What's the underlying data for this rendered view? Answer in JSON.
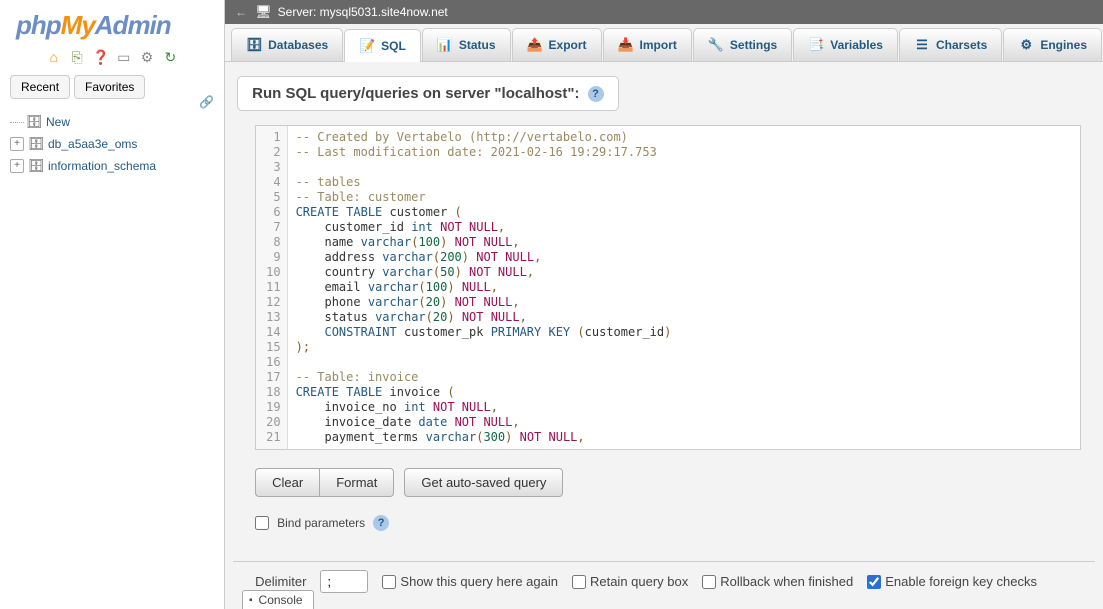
{
  "logo": {
    "part1": "php",
    "part2": "My",
    "part3": "Admin"
  },
  "sidebar": {
    "recent": "Recent",
    "favorites": "Favorites",
    "new": "New",
    "dbs": [
      "db_a5aa3e_oms",
      "information_schema"
    ]
  },
  "topbar": {
    "server_label": "Server:",
    "server_name": "mysql5031.site4now.net"
  },
  "tabs": {
    "databases": "Databases",
    "sql": "SQL",
    "status": "Status",
    "export": "Export",
    "import": "Import",
    "settings": "Settings",
    "variables": "Variables",
    "charsets": "Charsets",
    "engines": "Engines"
  },
  "panel": {
    "heading": "Run SQL query/queries on server \"localhost\":"
  },
  "code_lines": [
    {
      "n": 1,
      "t": "cmnt",
      "s": "-- Created by Vertabelo (http://vertabelo.com)"
    },
    {
      "n": 2,
      "t": "cmnt",
      "s": "-- Last modification date: 2021-02-16 19:29:17.753"
    },
    {
      "n": 3,
      "t": "",
      "s": ""
    },
    {
      "n": 4,
      "t": "cmnt",
      "s": "-- tables"
    },
    {
      "n": 5,
      "t": "cmnt",
      "s": "-- Table: customer"
    },
    {
      "n": 6,
      "t": "mix",
      "parts": [
        [
          "kw",
          "CREATE TABLE"
        ],
        [
          "",
          " "
        ],
        [
          "id",
          "customer"
        ],
        [
          "",
          " "
        ],
        [
          "p",
          "("
        ]
      ]
    },
    {
      "n": 7,
      "t": "mix",
      "parts": [
        [
          "",
          "    "
        ],
        [
          "id",
          "customer_id"
        ],
        [
          "",
          " "
        ],
        [
          "type",
          "int"
        ],
        [
          "",
          " "
        ],
        [
          "null",
          "NOT NULL"
        ],
        [
          "p",
          ","
        ]
      ]
    },
    {
      "n": 8,
      "t": "mix",
      "parts": [
        [
          "",
          "    "
        ],
        [
          "id",
          "name"
        ],
        [
          "",
          " "
        ],
        [
          "type",
          "varchar"
        ],
        [
          "p",
          "("
        ],
        [
          "num",
          "100"
        ],
        [
          "p",
          ")"
        ],
        [
          "",
          " "
        ],
        [
          "null",
          "NOT NULL"
        ],
        [
          "p",
          ","
        ]
      ]
    },
    {
      "n": 9,
      "t": "mix",
      "parts": [
        [
          "",
          "    "
        ],
        [
          "id",
          "address"
        ],
        [
          "",
          " "
        ],
        [
          "type",
          "varchar"
        ],
        [
          "p",
          "("
        ],
        [
          "num",
          "200"
        ],
        [
          "p",
          ")"
        ],
        [
          "",
          " "
        ],
        [
          "null",
          "NOT NULL"
        ],
        [
          "p",
          ","
        ]
      ]
    },
    {
      "n": 10,
      "t": "mix",
      "parts": [
        [
          "",
          "    "
        ],
        [
          "id",
          "country"
        ],
        [
          "",
          " "
        ],
        [
          "type",
          "varchar"
        ],
        [
          "p",
          "("
        ],
        [
          "num",
          "50"
        ],
        [
          "p",
          ")"
        ],
        [
          "",
          " "
        ],
        [
          "null",
          "NOT NULL"
        ],
        [
          "p",
          ","
        ]
      ]
    },
    {
      "n": 11,
      "t": "mix",
      "parts": [
        [
          "",
          "    "
        ],
        [
          "id",
          "email"
        ],
        [
          "",
          " "
        ],
        [
          "type",
          "varchar"
        ],
        [
          "p",
          "("
        ],
        [
          "num",
          "100"
        ],
        [
          "p",
          ")"
        ],
        [
          "",
          " "
        ],
        [
          "null",
          "NULL"
        ],
        [
          "p",
          ","
        ]
      ]
    },
    {
      "n": 12,
      "t": "mix",
      "parts": [
        [
          "",
          "    "
        ],
        [
          "id",
          "phone"
        ],
        [
          "",
          " "
        ],
        [
          "type",
          "varchar"
        ],
        [
          "p",
          "("
        ],
        [
          "num",
          "20"
        ],
        [
          "p",
          ")"
        ],
        [
          "",
          " "
        ],
        [
          "null",
          "NOT NULL"
        ],
        [
          "p",
          ","
        ]
      ]
    },
    {
      "n": 13,
      "t": "mix",
      "parts": [
        [
          "",
          "    "
        ],
        [
          "id",
          "status"
        ],
        [
          "",
          " "
        ],
        [
          "type",
          "varchar"
        ],
        [
          "p",
          "("
        ],
        [
          "num",
          "20"
        ],
        [
          "p",
          ")"
        ],
        [
          "",
          " "
        ],
        [
          "null",
          "NOT NULL"
        ],
        [
          "p",
          ","
        ]
      ]
    },
    {
      "n": 14,
      "t": "mix",
      "parts": [
        [
          "",
          "    "
        ],
        [
          "kw",
          "CONSTRAINT"
        ],
        [
          "",
          " "
        ],
        [
          "id",
          "customer_pk"
        ],
        [
          "",
          " "
        ],
        [
          "kw",
          "PRIMARY KEY"
        ],
        [
          "",
          " "
        ],
        [
          "p",
          "("
        ],
        [
          "id",
          "customer_id"
        ],
        [
          "p",
          ")"
        ]
      ]
    },
    {
      "n": 15,
      "t": "mix",
      "parts": [
        [
          "p",
          ")"
        ],
        [
          "p",
          ";"
        ]
      ]
    },
    {
      "n": 16,
      "t": "",
      "s": ""
    },
    {
      "n": 17,
      "t": "cmnt",
      "s": "-- Table: invoice"
    },
    {
      "n": 18,
      "t": "mix",
      "parts": [
        [
          "kw",
          "CREATE TABLE"
        ],
        [
          "",
          " "
        ],
        [
          "id",
          "invoice"
        ],
        [
          "",
          " "
        ],
        [
          "p",
          "("
        ]
      ]
    },
    {
      "n": 19,
      "t": "mix",
      "parts": [
        [
          "",
          "    "
        ],
        [
          "id",
          "invoice_no"
        ],
        [
          "",
          " "
        ],
        [
          "type",
          "int"
        ],
        [
          "",
          " "
        ],
        [
          "null",
          "NOT NULL"
        ],
        [
          "p",
          ","
        ]
      ]
    },
    {
      "n": 20,
      "t": "mix",
      "parts": [
        [
          "",
          "    "
        ],
        [
          "id",
          "invoice_date"
        ],
        [
          "",
          " "
        ],
        [
          "type",
          "date"
        ],
        [
          "",
          " "
        ],
        [
          "null",
          "NOT NULL"
        ],
        [
          "p",
          ","
        ]
      ]
    },
    {
      "n": 21,
      "t": "mix",
      "parts": [
        [
          "",
          "    "
        ],
        [
          "id",
          "payment_terms"
        ],
        [
          "",
          " "
        ],
        [
          "type",
          "varchar"
        ],
        [
          "p",
          "("
        ],
        [
          "num",
          "300"
        ],
        [
          "p",
          ")"
        ],
        [
          "",
          " "
        ],
        [
          "null",
          "NOT NULL"
        ],
        [
          "p",
          ","
        ]
      ]
    }
  ],
  "buttons": {
    "clear": "Clear",
    "format": "Format",
    "auto": "Get auto-saved query"
  },
  "bind": {
    "label": "Bind parameters"
  },
  "bottom": {
    "delimiter_label": "Delimiter",
    "delimiter_value": ";",
    "show_again": "Show this query here again",
    "retain": "Retain query box",
    "rollback": "Rollback when finished",
    "fk": "Enable foreign key checks"
  },
  "console": "Console"
}
